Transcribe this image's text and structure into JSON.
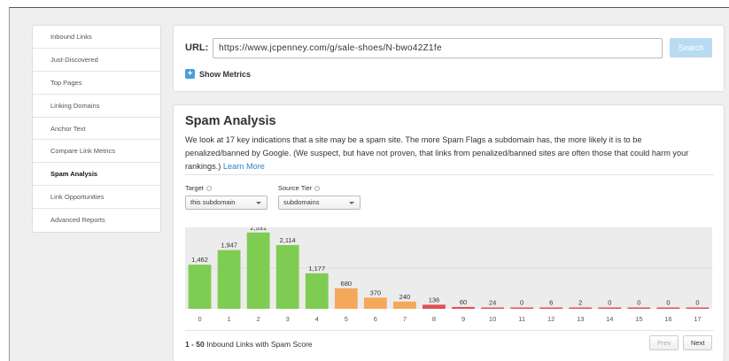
{
  "sidebar": {
    "items": [
      {
        "label": "Inbound Links"
      },
      {
        "label": "Just-Discovered"
      },
      {
        "label": "Top Pages"
      },
      {
        "label": "Linking Domains"
      },
      {
        "label": "Anchor Text"
      },
      {
        "label": "Compare Link Metrics"
      },
      {
        "label": "Spam Analysis",
        "active": true
      },
      {
        "label": "Link Opportunities"
      },
      {
        "label": "Advanced Reports"
      }
    ]
  },
  "url_panel": {
    "label": "URL:",
    "value": "https://www.jcpenney.com/g/sale-shoes/N-bwo42Z1fe",
    "search_label": "Search",
    "show_metrics_label": "Show Metrics",
    "plus_glyph": "+"
  },
  "spam": {
    "title": "Spam Analysis",
    "description": "We look at 17 key indications that a site may be a spam site. The more Spam Flags a subdomain has, the more likely it is to be penalized/banned by Google. (We suspect, but have not proven, that links from penalized/banned sites are often those that could harm your rankings.)",
    "learn_more": "Learn More",
    "target_label": "Target",
    "target_value": "this subdomain",
    "source_label": "Source Tier",
    "source_value": "subdomains",
    "results_range": "1 - 50",
    "results_text": "Inbound Links with Spam Score",
    "prev_label": "Prev",
    "next_label": "Next"
  },
  "colors": {
    "low": "#7fcc52",
    "medium": "#f3a85c",
    "high": "#e05050",
    "chart_bg": "#ececec"
  },
  "chart_data": {
    "type": "bar",
    "categories": [
      "0",
      "1",
      "2",
      "3",
      "4",
      "5",
      "6",
      "7",
      "8",
      "9",
      "10",
      "11",
      "12",
      "13",
      "14",
      "15",
      "16",
      "17"
    ],
    "values": [
      1462,
      1947,
      2531,
      2114,
      1177,
      680,
      370,
      240,
      136,
      60,
      24,
      0,
      6,
      2,
      0,
      0,
      0,
      0
    ],
    "value_labels": [
      "1,462",
      "1,947",
      "2,531",
      "2,114",
      "1,177",
      "680",
      "370",
      "240",
      "136",
      "60",
      "24",
      "0",
      "6",
      "2",
      "0",
      "0",
      "0",
      "0"
    ],
    "bar_colors": [
      "low",
      "low",
      "low",
      "low",
      "low",
      "medium",
      "medium",
      "medium",
      "high",
      "high",
      "high",
      "high",
      "high",
      "high",
      "high",
      "high",
      "high",
      "high"
    ],
    "ylim": [
      0,
      2700
    ],
    "grid": true
  }
}
